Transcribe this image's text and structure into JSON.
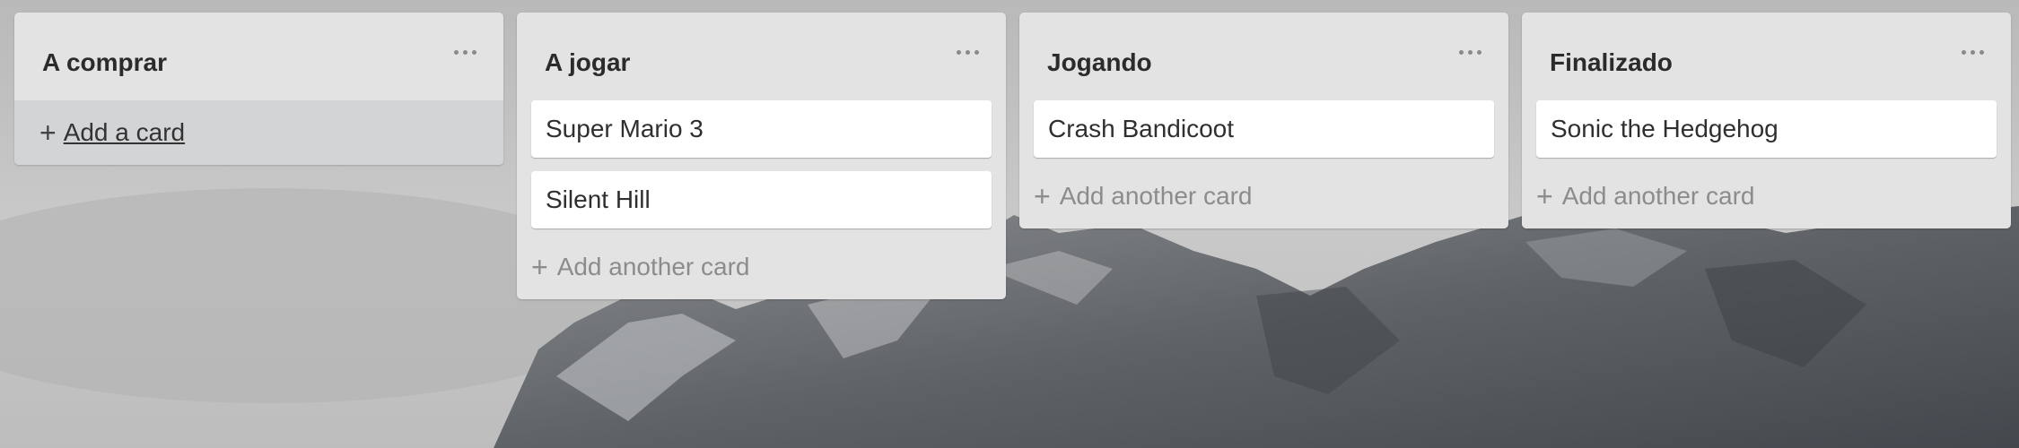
{
  "board": {
    "lists": [
      {
        "title": "A comprar",
        "cards": [],
        "add_label": "Add a card",
        "add_plus": "+"
      },
      {
        "title": "A jogar",
        "cards": [
          "Super Mario 3",
          "Silent Hill"
        ],
        "add_label": "Add another card",
        "add_plus": "+"
      },
      {
        "title": "Jogando",
        "cards": [
          "Crash Bandicoot"
        ],
        "add_label": "Add another card",
        "add_plus": "+"
      },
      {
        "title": "Finalizado",
        "cards": [
          "Sonic the Hedgehog"
        ],
        "add_label": "Add another card",
        "add_plus": "+"
      }
    ]
  },
  "icons": {
    "menu": "ellipsis-icon",
    "add": "plus-icon"
  },
  "colors": {
    "list_bg": "#e3e3e4",
    "card_bg": "#ffffff",
    "muted_text": "#8c8c8c",
    "title_text": "#2b2b2b"
  }
}
